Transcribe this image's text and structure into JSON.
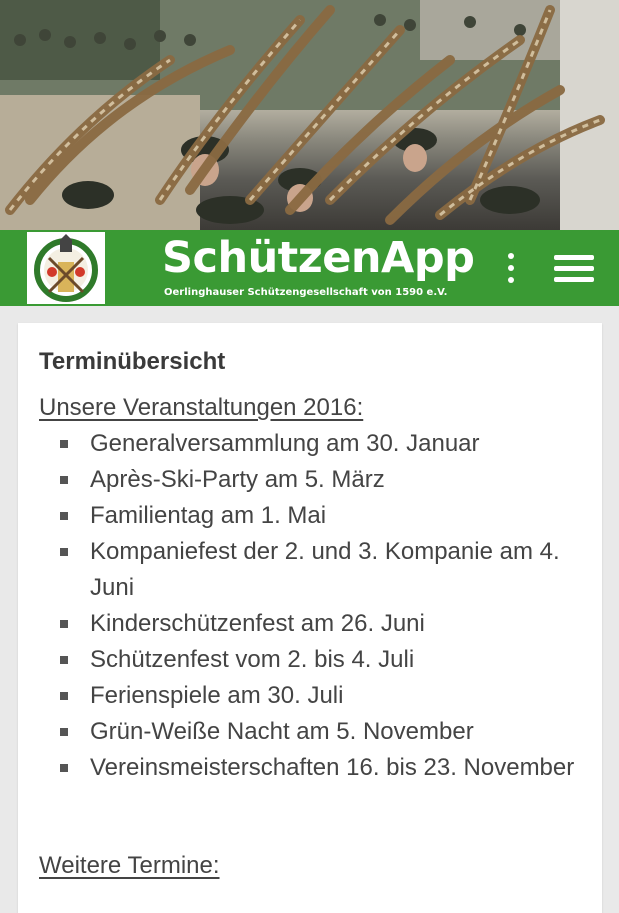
{
  "colors": {
    "brand_green": "#3a9a34",
    "background": "#e9e9e9",
    "text": "#444444"
  },
  "header": {
    "title": "SchützenApp",
    "subtitle": "Oerlinghauser Schützengesellschaft von 1590 e.V.",
    "logo": "club-crest-icon",
    "overflow_icon": "more-vert-icon",
    "menu_icon": "hamburger-menu-icon"
  },
  "content": {
    "title": "Terminübersicht",
    "section_2016": "Unsere Veranstaltungen 2016:",
    "events": [
      "Generalversammlung am 30. Januar",
      "Après-Ski-Party am 5. März",
      "Familientag am 1. Mai",
      "Kompaniefest der 2. und 3. Kompanie am 4. Juni",
      "Kinderschützenfest am 26. Juni",
      "Schützenfest vom 2. bis 4. Juli",
      "Ferienspiele am 30. Juli",
      "Grün-Weiße Nacht am 5. November",
      "Vereinsmeisterschaften 16. bis 23. November"
    ],
    "section_more": "Weitere Termine:"
  }
}
